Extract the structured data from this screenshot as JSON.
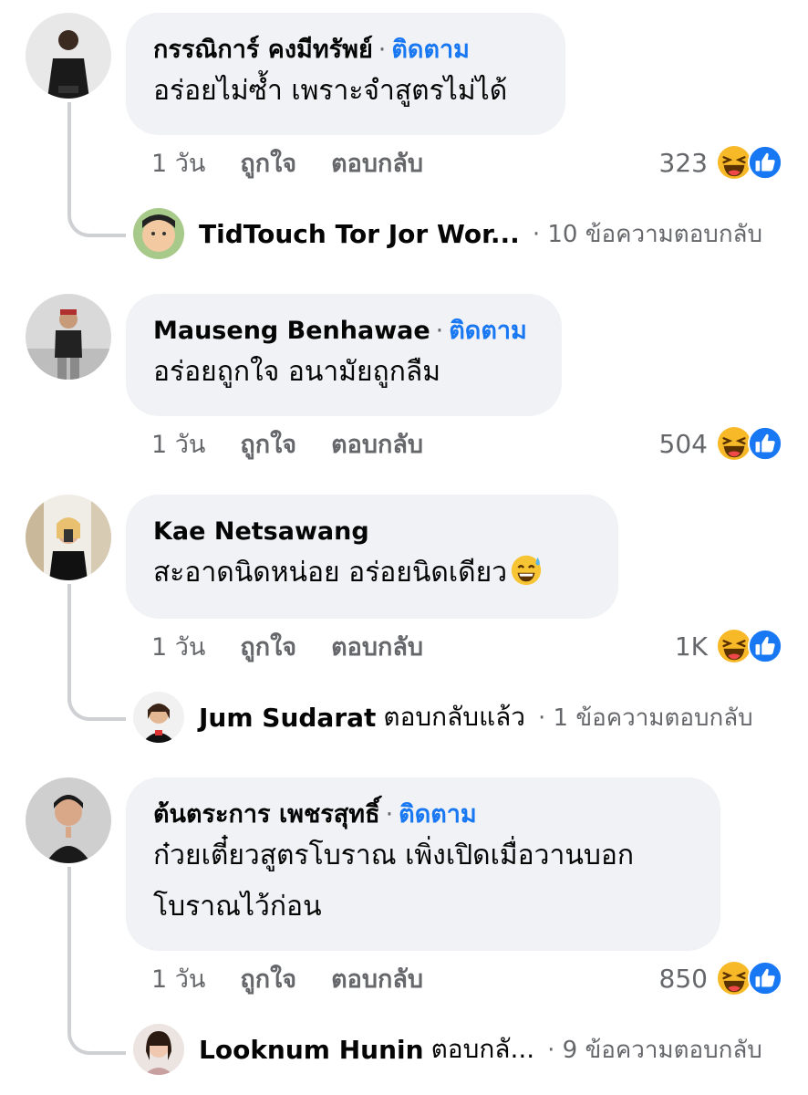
{
  "comments": [
    {
      "author": "กรรณิการ์ คงมีทรัพย์",
      "dot": "·",
      "follow": "ติดตาม",
      "text_lines": [
        "อร่อยไม่ซ้ำ เพราะจำสูตรไม่ได้"
      ],
      "time": "1 วัน",
      "like": "ถูกใจ",
      "reply": "ตอบกลับ",
      "reaction_count": "323",
      "reply_preview": {
        "name": "TidTouch Tor Jor Wor...",
        "extra": "",
        "count": "· 10 ข้อความตอบกลับ"
      }
    },
    {
      "author": "Mauseng Benhawae",
      "dot": "·",
      "follow": "ติดตาม",
      "text_lines": [
        "อร่อยถูกใจ อนามัยถูกลืม"
      ],
      "time": "1 วัน",
      "like": "ถูกใจ",
      "reply": "ตอบกลับ",
      "reaction_count": "504"
    },
    {
      "author": "Kae Netsawang",
      "text_lines": [
        "สะอาดนิดหน่อย อร่อยนิดเดียว"
      ],
      "time": "1 วัน",
      "like": "ถูกใจ",
      "reply": "ตอบกลับ",
      "reaction_count": "1K",
      "reply_preview": {
        "name": "Jum Sudarat",
        "extra": "ตอบกลับแล้ว",
        "count": "· 1 ข้อความตอบกลับ"
      }
    },
    {
      "author": "ต้นตระการ เพชรสุทธิ์",
      "dot": "·",
      "follow": "ติดตาม",
      "text_lines": [
        "ก๋วยเตี๋ยวสูตรโบราณ เพิ่งเปิดเมื่อวานบอก",
        "โบราณไว้ก่อน"
      ],
      "time": "1 วัน",
      "like": "ถูกใจ",
      "reply": "ตอบกลับ",
      "reaction_count": "850",
      "reply_preview": {
        "name": "Looknum Hunin",
        "extra": "ตอบกลั...",
        "count": "· 9 ข้อความตอบกลับ"
      }
    }
  ],
  "icons": {
    "haha": "haha-reaction-icon",
    "like": "like-reaction-icon",
    "sweat_smile": "grinning-sweat-emoji"
  },
  "colors": {
    "bubble": "#f0f2f5",
    "follow": "#1877f2",
    "meta": "#65676b",
    "thread": "#ced0d4",
    "haha": "#f7b928",
    "like": "#1877f2"
  }
}
